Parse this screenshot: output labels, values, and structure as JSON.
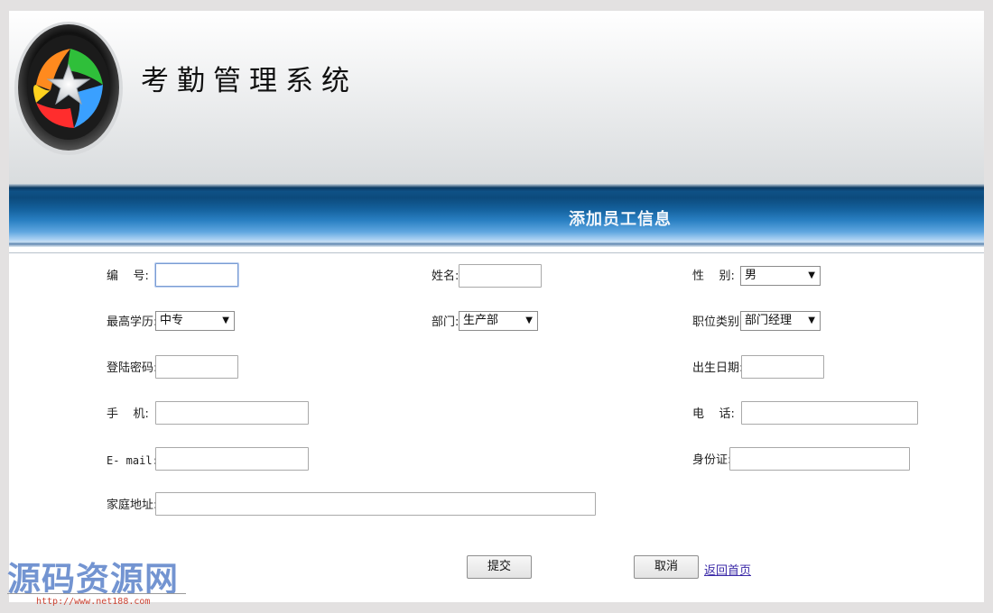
{
  "header": {
    "system_title": "考勤管理系统"
  },
  "banner": {
    "title": "添加员工信息"
  },
  "form": {
    "id_label": "编    号:",
    "id_value": "",
    "name_label": "姓名:",
    "name_value": "",
    "gender_label": "性    别:",
    "gender_value": "男",
    "education_label": "最高学历:",
    "education_value": "中专",
    "department_label": "部门:",
    "department_value": "生产部",
    "position_label": "职位类别:",
    "position_value": "部门经理",
    "password_label": "登陆密码:",
    "password_value": "",
    "birthdate_label": "出生日期:",
    "birthdate_value": "",
    "mobile_label": "手    机:",
    "mobile_value": "",
    "phone_label": "电    话:",
    "phone_value": "",
    "email_label": "E- mail:",
    "email_value": "",
    "idcard_label": "身份证:",
    "idcard_value": "",
    "address_label": "家庭地址:",
    "address_value": ""
  },
  "actions": {
    "submit_label": "提交",
    "cancel_label": "取消",
    "home_link_label": "返回首页"
  },
  "watermark": {
    "text": "源码资源网",
    "url": "http://www.net188.com"
  },
  "colors": {
    "banner_dark": "#0c4a7c",
    "banner_light": "#5fa6e0",
    "link": "#3b2aa8",
    "watermark": "#6c8fcf"
  }
}
